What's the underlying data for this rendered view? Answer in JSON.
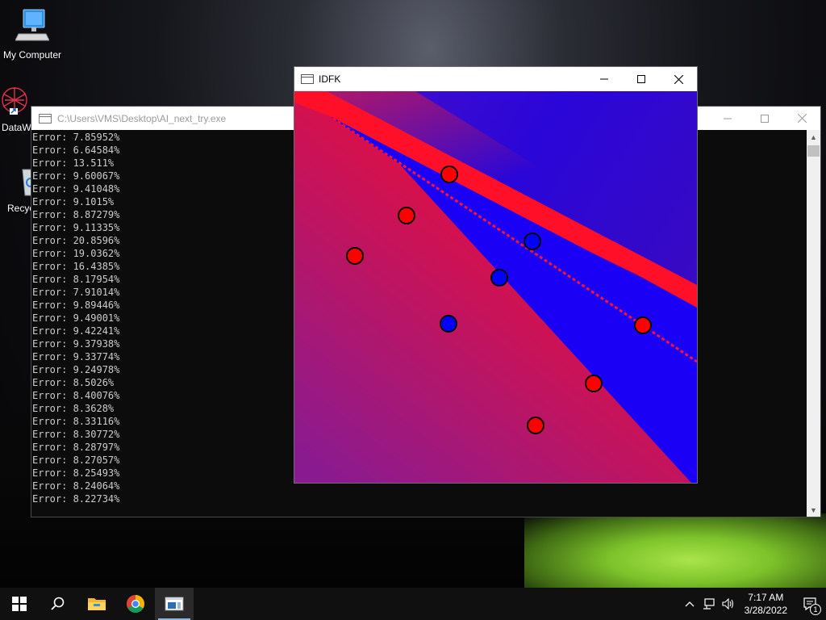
{
  "desktop": {
    "icons": [
      {
        "label": "My Computer"
      },
      {
        "label": "DataW"
      },
      {
        "label": "Recyc"
      }
    ]
  },
  "console": {
    "title": "C:\\Users\\VMS\\Desktop\\AI_next_try.exe",
    "lines": [
      "Error: 7.85952%",
      "Error: 6.64584%",
      "Error: 13.511%",
      "Error: 9.60067%",
      "Error: 9.41048%",
      "Error: 9.1015%",
      "Error: 8.87279%",
      "Error: 9.11335%",
      "Error: 20.8596%",
      "Error: 19.0362%",
      "Error: 16.4385%",
      "Error: 8.17954%",
      "Error: 7.91014%",
      "Error: 9.89446%",
      "Error: 9.49001%",
      "Error: 9.42241%",
      "Error: 9.37938%",
      "Error: 9.33774%",
      "Error: 9.24978%",
      "Error: 8.5026%",
      "Error: 8.40076%",
      "Error: 8.3628%",
      "Error: 8.33116%",
      "Error: 8.30772%",
      "Error: 8.28797%",
      "Error: 8.27057%",
      "Error: 8.25493%",
      "Error: 8.24064%",
      "Error: 8.22734%"
    ]
  },
  "idfk_window": {
    "title": "IDFK"
  },
  "taskbar": {
    "apps": [
      "start-button",
      "search-button",
      "file-explorer",
      "chrome",
      "console-app"
    ],
    "time": "7:17 AM",
    "date": "3/28/2022",
    "notification_count": "1"
  },
  "colors": {
    "class_red": "#ff0000",
    "class_blue": "#0000ff",
    "outline": "#000000"
  }
}
